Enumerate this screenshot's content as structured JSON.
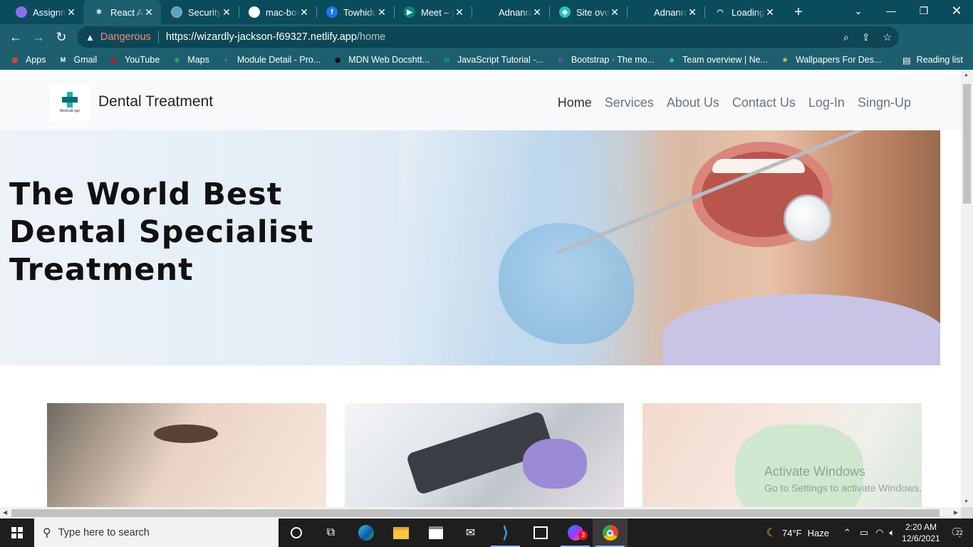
{
  "browser": {
    "tabs": [
      {
        "title": "Assignm",
        "fav_color": "#8e6cef",
        "fav_glyph": "",
        "icon": "purple-brush-icon",
        "active": false
      },
      {
        "title": "React Ap",
        "fav_color": "#1d5f6e",
        "fav_glyph": "⚛",
        "icon": "react-icon",
        "active": true
      },
      {
        "title": "Security",
        "fav_color": "#9aa0a6",
        "fav_glyph": "🌐",
        "icon": "globe-icon",
        "active": false
      },
      {
        "title": "mac-boo",
        "fav_color": "#ffffff",
        "fav_glyph": "",
        "icon": "globe-icon",
        "active": false
      },
      {
        "title": "Towhidu",
        "fav_color": "#1877f2",
        "fav_glyph": "f",
        "icon": "facebook-icon",
        "active": false
      },
      {
        "title": "Meet – j",
        "fav_color": "#00897b",
        "fav_glyph": "▶",
        "icon": "meet-icon",
        "active": false
      },
      {
        "title": "Adnanra",
        "fav_color": "#0b4c5c",
        "fav_glyph": "",
        "icon": "github-icon",
        "active": false
      },
      {
        "title": "Site over",
        "fav_color": "#20c6b6",
        "fav_glyph": "◆",
        "icon": "netlify-icon",
        "active": false
      },
      {
        "title": "Adnanra",
        "fav_color": "#0b4c5c",
        "fav_glyph": "",
        "icon": "github-icon",
        "active": false
      },
      {
        "title": "Loading",
        "fav_color": "#0b4c5c",
        "fav_glyph": "◠",
        "icon": "loading-spinner-icon",
        "active": false
      }
    ],
    "security_label": "Dangerous",
    "url_host": "https://wizardly-jackson-f69327.netlify.app",
    "url_path": "/home",
    "bookmarks": [
      {
        "label": "Apps",
        "icon": "apps-grid-icon",
        "color": "#ea4335",
        "glyph": "▦"
      },
      {
        "label": "Gmail",
        "icon": "gmail-icon",
        "color": "#ffffff",
        "glyph": "M"
      },
      {
        "label": "YouTube",
        "icon": "youtube-icon",
        "color": "#ff0000",
        "glyph": "▶"
      },
      {
        "label": "Maps",
        "icon": "maps-icon",
        "color": "#34a853",
        "glyph": "◆"
      },
      {
        "label": "Module Detail - Pro...",
        "icon": "module-icon",
        "color": "#8e6cef",
        "glyph": "◐"
      },
      {
        "label": "MDN Web Docshtt...",
        "icon": "mdn-icon",
        "color": "#000000",
        "glyph": "◉"
      },
      {
        "label": "JavaScript Tutorial -...",
        "icon": "w3-icon",
        "color": "#04aa6d",
        "glyph": "W"
      },
      {
        "label": "Bootstrap · The mo...",
        "icon": "bootstrap-icon",
        "color": "#7952b3",
        "glyph": "B"
      },
      {
        "label": "Team overview | Ne...",
        "icon": "netlify-icon",
        "color": "#20c6b6",
        "glyph": "◆"
      },
      {
        "label": "Wallpapers For Des...",
        "icon": "star-icon",
        "color": "#f2c14e",
        "glyph": "★"
      }
    ],
    "reading_list": "Reading list"
  },
  "site": {
    "brand": "Dental Treatment",
    "logo_text": "MedicalLogo",
    "nav": [
      {
        "label": "Home",
        "active": true
      },
      {
        "label": "Services",
        "active": false
      },
      {
        "label": "About Us",
        "active": false
      },
      {
        "label": "Contact Us",
        "active": false
      },
      {
        "label": "Log-In",
        "active": false
      },
      {
        "label": "Singn-Up",
        "active": false
      }
    ],
    "hero_title": "The World Best Dental Specialist Treatment"
  },
  "watermark": {
    "line1": "Activate Windows",
    "line2": "Go to Settings to activate Windows."
  },
  "taskbar": {
    "search_placeholder": "Type here to search",
    "weather_temp": "74°F",
    "weather_desc": "Haze",
    "time": "2:20 AM",
    "date": "12/6/2021",
    "notifications": "22",
    "messenger_badge": "3"
  }
}
